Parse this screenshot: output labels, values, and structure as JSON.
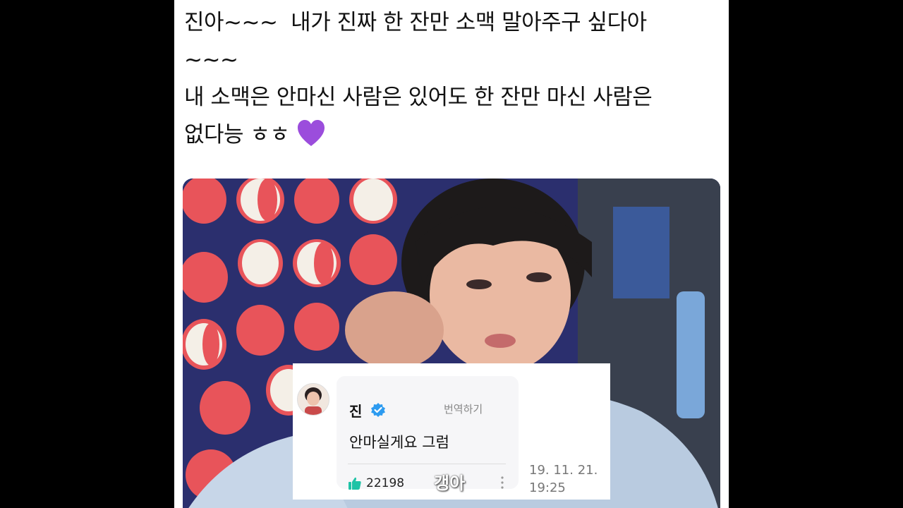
{
  "post": {
    "line1": "진아~~~  내가 진짜 한 잔만 소맥 말아주구 싶다아",
    "line2": "~~~",
    "line3": "내 소맥은 안마신 사람은 있어도 한 잔만 마신 사람은",
    "line4": "없다능 ㅎㅎ",
    "heart_emoji": "purple-heart-icon"
  },
  "comment": {
    "author": "진",
    "translate_label": "번역하기",
    "text": "안마실게요 그럼",
    "like_count": "22198",
    "timestamp_line1": "19. 11. 21.",
    "timestamp_line2": "19:25",
    "verified_icon": "verified-badge-icon"
  },
  "watermark": "갱아",
  "colors": {
    "verified": "#2d9bf0",
    "like": "#1ec3a6",
    "heart": "#9b4ddc",
    "pomegranate": "#e8545a",
    "wall": "#2b2f6e"
  }
}
